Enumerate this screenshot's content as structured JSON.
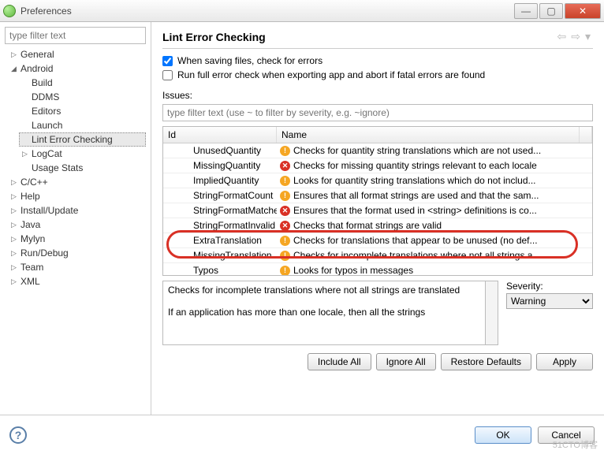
{
  "window": {
    "title": "Preferences"
  },
  "sidebar": {
    "filter_placeholder": "type filter text",
    "items": [
      {
        "label": "General",
        "exp": "▷"
      },
      {
        "label": "Android",
        "exp": "◢",
        "children": [
          {
            "label": "Build"
          },
          {
            "label": "DDMS"
          },
          {
            "label": "Editors"
          },
          {
            "label": "Launch"
          },
          {
            "label": "Lint Error Checking",
            "selected": true
          },
          {
            "label": "LogCat",
            "exp": "▷"
          },
          {
            "label": "Usage Stats"
          }
        ]
      },
      {
        "label": "C/C++",
        "exp": "▷"
      },
      {
        "label": "Help",
        "exp": "▷"
      },
      {
        "label": "Install/Update",
        "exp": "▷"
      },
      {
        "label": "Java",
        "exp": "▷"
      },
      {
        "label": "Mylyn",
        "exp": "▷"
      },
      {
        "label": "Run/Debug",
        "exp": "▷"
      },
      {
        "label": "Team",
        "exp": "▷"
      },
      {
        "label": "XML",
        "exp": "▷"
      }
    ]
  },
  "page": {
    "heading": "Lint Error Checking",
    "check_save": "When saving files, check for errors",
    "check_export": "Run full error check when exporting app and abort if fatal errors are found",
    "issues_label": "Issues:",
    "issues_filter_placeholder": "type filter text (use ~ to filter by severity, e.g. ~ignore)",
    "columns": {
      "id": "Id",
      "name": "Name"
    },
    "rows": [
      {
        "id": "UnusedQuantity",
        "sev": "warn",
        "name": "Checks for quantity string translations which are not used..."
      },
      {
        "id": "MissingQuantity",
        "sev": "err",
        "name": "Checks for missing quantity strings relevant to each locale"
      },
      {
        "id": "ImpliedQuantity",
        "sev": "warn",
        "name": "Looks for quantity string translations which do not includ..."
      },
      {
        "id": "StringFormatCount",
        "sev": "warn",
        "name": "Ensures that all format strings are used and that the sam..."
      },
      {
        "id": "StringFormatMatches",
        "sev": "err",
        "name": "Ensures that the format used in <string> definitions is co..."
      },
      {
        "id": "StringFormatInvalid",
        "sev": "err",
        "name": "Checks that format strings are valid"
      },
      {
        "id": "ExtraTranslation",
        "sev": "warn",
        "name": "Checks for translations that appear to be unused (no def..."
      },
      {
        "id": "MissingTranslation",
        "sev": "warn",
        "name": "Checks for incomplete translations where not all strings a..."
      },
      {
        "id": "Typos",
        "sev": "warn",
        "name": "Looks for typos in messages"
      }
    ],
    "description_line1": "Checks for incomplete translations where not all strings are translated",
    "description_line2": "If an application has more than one locale, then all the strings",
    "severity_label": "Severity:",
    "severity_value": "Warning",
    "buttons": {
      "include": "Include All",
      "ignore": "Ignore All",
      "restore": "Restore Defaults",
      "apply": "Apply"
    }
  },
  "footer": {
    "ok": "OK",
    "cancel": "Cancel"
  },
  "watermark": "51CTO博客"
}
